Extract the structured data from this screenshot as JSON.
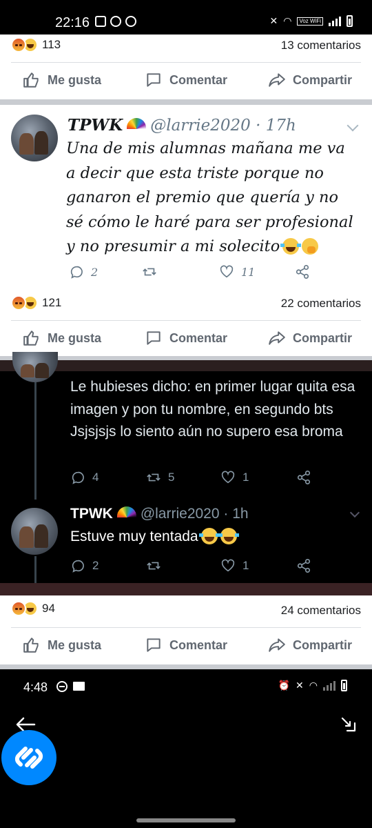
{
  "statusbar": {
    "time": "22:16",
    "net": "Voz WiFi"
  },
  "posts": [
    {
      "reaction_count": "113",
      "comments": "13 comentarios"
    },
    {
      "reaction_count": "121",
      "comments": "22 comentarios"
    },
    {
      "reaction_count": "94",
      "comments": "24 comentarios"
    }
  ],
  "actions": {
    "like": "Me gusta",
    "comment": "Comentar",
    "share": "Compartir"
  },
  "tweet_light": {
    "name": "TPWK",
    "handle": "@larrie2020 · 17h",
    "text": "Una de mis alumnas mañana me va a decir que esta triste porque no ganaron el premio que quería y no sé cómo le haré para ser profesional y no presumir a mi solecito",
    "replies": "2",
    "likes": "11"
  },
  "tweet_dark_1": {
    "text": "Le hubieses dicho: en primer lugar quita esa imagen y pon tu nombre, en segundo bts Jsjsjsjs lo siento aún no supero esa broma",
    "replies": "4",
    "retweets": "5",
    "likes": "1"
  },
  "tweet_dark_2": {
    "name": "TPWK",
    "handle": "@larrie2020 · 1h",
    "text": "Estuve muy tentada",
    "replies": "2",
    "likes": "1"
  },
  "phone_bottom": {
    "time": "4:48"
  },
  "colors": {
    "fb_gray": "#606770",
    "twitter_light_gray": "#657786",
    "shazam_blue": "#0088ff"
  }
}
